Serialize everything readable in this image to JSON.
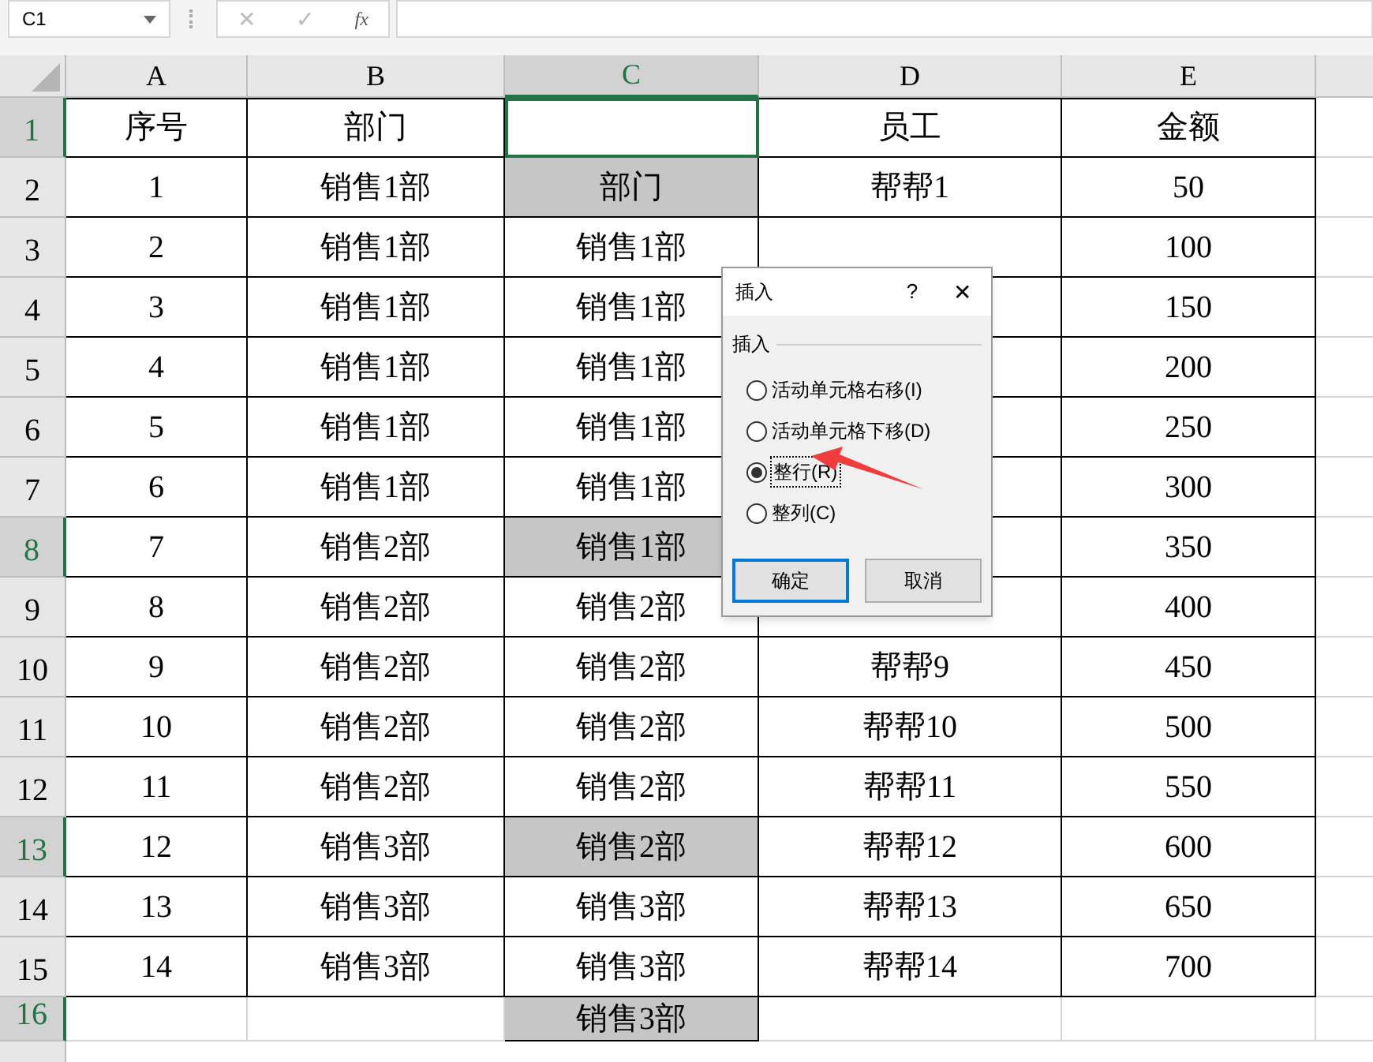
{
  "formula_bar": {
    "name_box": "C1",
    "cancel": "✕",
    "enter": "✓",
    "function": "fx"
  },
  "columns": [
    {
      "label": "A",
      "selected": false
    },
    {
      "label": "B",
      "selected": false
    },
    {
      "label": "C",
      "selected": true
    },
    {
      "label": "D",
      "selected": false
    },
    {
      "label": "E",
      "selected": false
    }
  ],
  "rows": [
    {
      "number": "1",
      "selected": true,
      "c_shaded": false,
      "cells": [
        "序号",
        "部门",
        "",
        "员工",
        "金额"
      ]
    },
    {
      "number": "2",
      "selected": false,
      "c_shaded": true,
      "cells": [
        "1",
        "销售1部",
        "部门",
        "帮帮1",
        "50"
      ]
    },
    {
      "number": "3",
      "selected": false,
      "c_shaded": false,
      "cells": [
        "2",
        "销售1部",
        "销售1部",
        "",
        "100"
      ]
    },
    {
      "number": "4",
      "selected": false,
      "c_shaded": false,
      "cells": [
        "3",
        "销售1部",
        "销售1部",
        "",
        "150"
      ]
    },
    {
      "number": "5",
      "selected": false,
      "c_shaded": false,
      "cells": [
        "4",
        "销售1部",
        "销售1部",
        "",
        "200"
      ]
    },
    {
      "number": "6",
      "selected": false,
      "c_shaded": false,
      "cells": [
        "5",
        "销售1部",
        "销售1部",
        "",
        "250"
      ]
    },
    {
      "number": "7",
      "selected": false,
      "c_shaded": false,
      "cells": [
        "6",
        "销售1部",
        "销售1部",
        "",
        "300"
      ]
    },
    {
      "number": "8",
      "selected": true,
      "c_shaded": true,
      "cells": [
        "7",
        "销售2部",
        "销售1部",
        "",
        "350"
      ]
    },
    {
      "number": "9",
      "selected": false,
      "c_shaded": false,
      "cells": [
        "8",
        "销售2部",
        "销售2部",
        "",
        "400"
      ]
    },
    {
      "number": "10",
      "selected": false,
      "c_shaded": false,
      "cells": [
        "9",
        "销售2部",
        "销售2部",
        "帮帮9",
        "450"
      ]
    },
    {
      "number": "11",
      "selected": false,
      "c_shaded": false,
      "cells": [
        "10",
        "销售2部",
        "销售2部",
        "帮帮10",
        "500"
      ]
    },
    {
      "number": "12",
      "selected": false,
      "c_shaded": false,
      "cells": [
        "11",
        "销售2部",
        "销售2部",
        "帮帮11",
        "550"
      ]
    },
    {
      "number": "13",
      "selected": true,
      "c_shaded": true,
      "cells": [
        "12",
        "销售3部",
        "销售2部",
        "帮帮12",
        "600"
      ]
    },
    {
      "number": "14",
      "selected": false,
      "c_shaded": false,
      "cells": [
        "13",
        "销售3部",
        "销售3部",
        "帮帮13",
        "650"
      ]
    },
    {
      "number": "15",
      "selected": false,
      "c_shaded": false,
      "cells": [
        "14",
        "销售3部",
        "销售3部",
        "帮帮14",
        "700"
      ]
    },
    {
      "number": "16",
      "selected": true,
      "c_shaded": true,
      "cells": [
        "",
        "",
        "销售3部",
        "",
        ""
      ]
    }
  ],
  "dialog": {
    "title": "插入",
    "help": "?",
    "close": "✕",
    "group_label": "插入",
    "options": [
      {
        "label": "活动单元格右移(I)",
        "selected": false
      },
      {
        "label": "活动单元格下移(D)",
        "selected": false
      },
      {
        "label": "整行(R)",
        "selected": true
      },
      {
        "label": "整列(C)",
        "selected": false
      }
    ],
    "buttons": [
      {
        "label": "确定",
        "kind": "default"
      },
      {
        "label": "取消",
        "kind": "normal"
      }
    ]
  }
}
